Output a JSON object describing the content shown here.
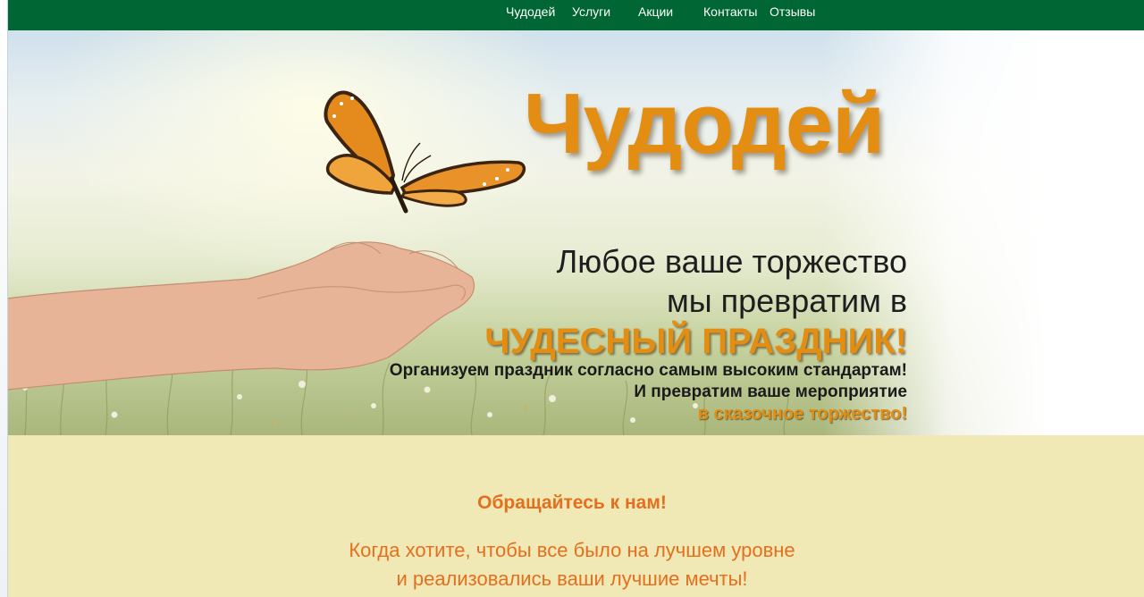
{
  "nav": {
    "items": [
      {
        "label": "Чудодей"
      },
      {
        "label": "Услуги"
      },
      {
        "label": "Акции"
      },
      {
        "label": "Контакты"
      },
      {
        "label": "Отзывы"
      }
    ]
  },
  "hero": {
    "brand": "Чудодей",
    "tagline_line1": "Любое ваше торжество",
    "tagline_line2": "мы превратим в",
    "tagline_highlight": "ЧУДЕСНЫЙ ПРАЗДНИК!",
    "sub_line1": "Организуем праздник согласно самым высоким стандартам!",
    "sub_line2": "И превратим ваше мероприятие",
    "sub_highlight": "в сказочное торжество!"
  },
  "promo": {
    "heading": "Обращайтесь к нам!",
    "line1": "Когда хотите, чтобы все было на лучшем уровне",
    "line2": "и реализовались ваши лучшие мечты!"
  },
  "colors": {
    "nav_bg": "#006633",
    "accent_orange": "#e38e12",
    "promo_text": "#e46f1f",
    "promo_bg": "#f1e9b5"
  },
  "icons": [
    "butterfly-illustration",
    "open-hands-illustration"
  ]
}
